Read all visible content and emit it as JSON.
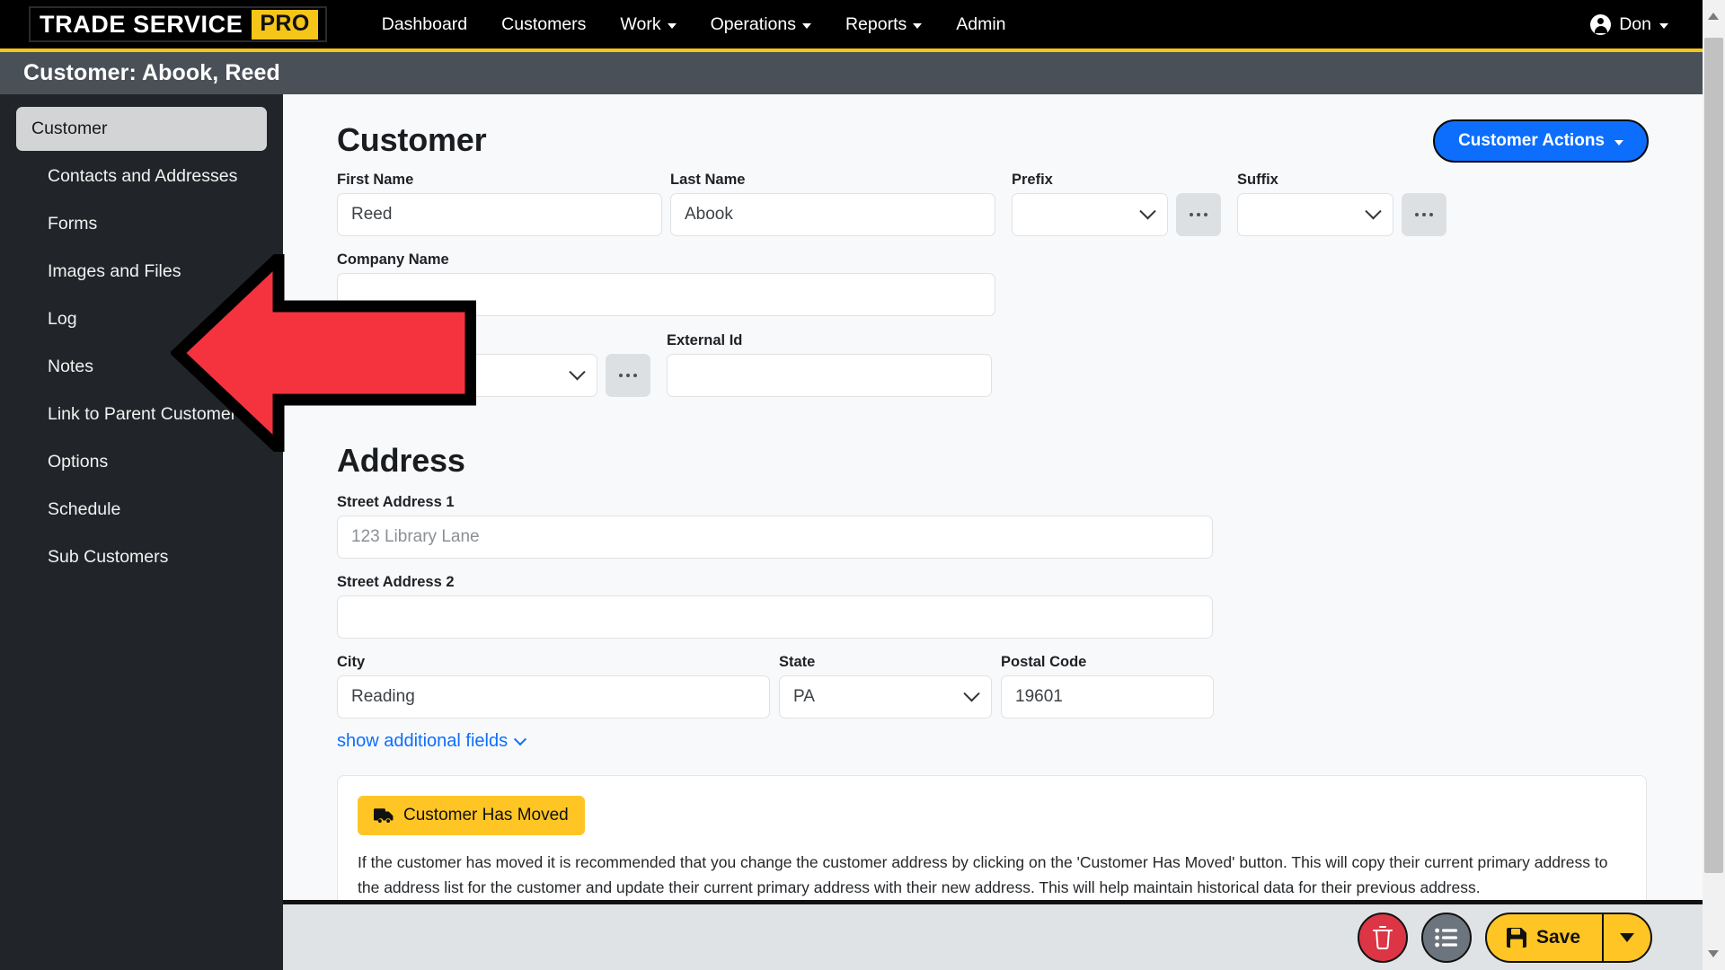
{
  "navbar": {
    "brand_main": "TRADE SERVICE",
    "brand_accent": "PRO",
    "links": [
      {
        "label": "Dashboard",
        "has_caret": false
      },
      {
        "label": "Customers",
        "has_caret": false
      },
      {
        "label": "Work",
        "has_caret": true
      },
      {
        "label": "Operations",
        "has_caret": true
      },
      {
        "label": "Reports",
        "has_caret": true
      },
      {
        "label": "Admin",
        "has_caret": false
      }
    ],
    "user": "Don"
  },
  "titlebar": {
    "title": "Customer: Abook, Reed"
  },
  "sidebar": {
    "items": [
      {
        "label": "Customer",
        "active": true
      },
      {
        "label": "Contacts and Addresses",
        "active": false
      },
      {
        "label": "Forms",
        "active": false
      },
      {
        "label": "Images and Files",
        "active": false
      },
      {
        "label": "Log",
        "active": false
      },
      {
        "label": "Notes",
        "active": false
      },
      {
        "label": "Link to Parent Customer",
        "active": false
      },
      {
        "label": "Options",
        "active": false
      },
      {
        "label": "Schedule",
        "active": false
      },
      {
        "label": "Sub Customers",
        "active": false
      }
    ]
  },
  "customer": {
    "heading": "Customer",
    "actions_button": "Customer Actions",
    "first_name_label": "First Name",
    "first_name_value": "Reed",
    "last_name_label": "Last Name",
    "last_name_value": "Abook",
    "prefix_label": "Prefix",
    "prefix_value": "",
    "suffix_label": "Suffix",
    "suffix_value": "",
    "company_name_label": "Company Name",
    "company_name_value": "",
    "external_id_label": "External Id",
    "external_id_value": "",
    "hidden_select_value": ""
  },
  "address": {
    "heading": "Address",
    "street1_label": "Street Address 1",
    "street1_value": "123 Library Lane",
    "street2_label": "Street Address 2",
    "street2_value": "",
    "city_label": "City",
    "city_value": "Reading",
    "state_label": "State",
    "state_value": "PA",
    "postal_label": "Postal Code",
    "postal_value": "19601",
    "show_additional": "show additional fields"
  },
  "moved": {
    "button_label": "Customer Has Moved",
    "description": "If the customer has moved it is recommended that you change the customer address by clicking on the 'Customer Has Moved' button. This will copy their current primary address to the address list for the customer and update their current primary address with their new address. This will help maintain historical data for their previous address."
  },
  "bottombar": {
    "save_label": "Save"
  },
  "colors": {
    "brand_yellow": "#F5C518",
    "nav_black": "#000000",
    "titlebar_gray": "#4A5058",
    "sidebar_dark": "#212529",
    "primary_blue": "#0d6efd",
    "danger_red": "#DC3545",
    "save_yellow": "#FFC524",
    "annotation_red": "#F5333F"
  }
}
